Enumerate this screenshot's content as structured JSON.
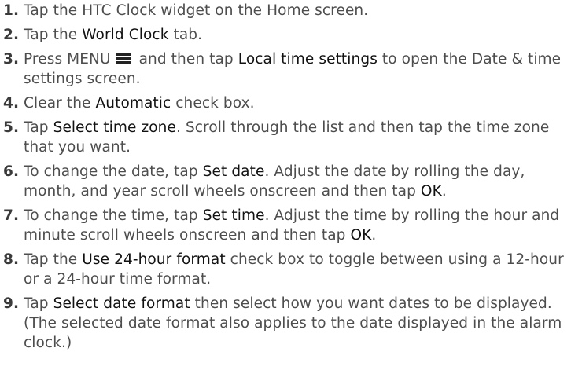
{
  "steps": [
    {
      "num": "1.",
      "parts": [
        {
          "t": "Tap the HTC Clock widget on the Home screen."
        }
      ]
    },
    {
      "num": "2.",
      "parts": [
        {
          "t": "Tap the "
        },
        {
          "t": "World Clock",
          "b": true
        },
        {
          "t": " tab."
        }
      ]
    },
    {
      "num": "3.",
      "parts": [
        {
          "t": "Press MENU "
        },
        {
          "icon": "menu-icon"
        },
        {
          "t": " and then tap "
        },
        {
          "t": "Local time settings",
          "b": true
        },
        {
          "t": " to open the Date & time settings screen."
        }
      ]
    },
    {
      "num": "4.",
      "parts": [
        {
          "t": "Clear the "
        },
        {
          "t": "Automatic",
          "b": true
        },
        {
          "t": " check box."
        }
      ]
    },
    {
      "num": "5.",
      "parts": [
        {
          "t": "Tap "
        },
        {
          "t": "Select time zone",
          "b": true
        },
        {
          "t": ". Scroll through the list and then tap the time zone that you want."
        }
      ]
    },
    {
      "num": "6.",
      "parts": [
        {
          "t": "To change the date, tap "
        },
        {
          "t": "Set date",
          "b": true
        },
        {
          "t": ". Adjust the date by rolling the day, month, and year scroll wheels onscreen and then tap "
        },
        {
          "t": "OK",
          "b": true
        },
        {
          "t": "."
        }
      ]
    },
    {
      "num": "7.",
      "parts": [
        {
          "t": "To change the time, tap "
        },
        {
          "t": "Set time",
          "b": true
        },
        {
          "t": ". Adjust the time by rolling the hour and minute scroll wheels onscreen and then tap "
        },
        {
          "t": "OK",
          "b": true
        },
        {
          "t": "."
        }
      ]
    },
    {
      "num": "8.",
      "parts": [
        {
          "t": "Tap the "
        },
        {
          "t": "Use 24-hour format",
          "b": true
        },
        {
          "t": " check box to toggle between using a 12-hour or a 24-hour time format."
        }
      ]
    },
    {
      "num": "9.",
      "parts": [
        {
          "t": "Tap "
        },
        {
          "t": "Select date format",
          "b": true
        },
        {
          "t": " then select how you want dates to be displayed. (The selected date format also applies to the date displayed in the alarm clock.)"
        }
      ]
    }
  ]
}
